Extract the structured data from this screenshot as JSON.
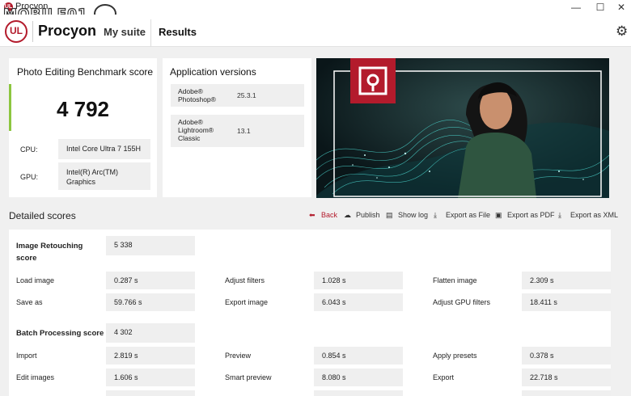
{
  "window": {
    "title": "Procyon",
    "watermark": "MOBILE01",
    "controls": [
      "—",
      "☐",
      "✕"
    ]
  },
  "app": {
    "logo": "UL",
    "brand": "Procyon",
    "nav": [
      "My suite",
      "Results"
    ],
    "active_tab": "Results",
    "accent": "#b31b2c"
  },
  "score_card": {
    "title": "Photo Editing Benchmark score",
    "score": "4 792",
    "cpu_label": "CPU:",
    "cpu_value": "Intel Core Ultra 7 155H",
    "gpu_label": "GPU:",
    "gpu_value": "Intel(R) Arc(TM) Graphics"
  },
  "app_versions": {
    "title": "Application versions",
    "items": [
      {
        "name": "Adobe® Photoshop®",
        "version": "25.3.1"
      },
      {
        "name": "Adobe® Lightroom® Classic",
        "version": "13.1"
      }
    ]
  },
  "detailed": {
    "title": "Detailed scores",
    "actions": [
      "Back",
      "Publish",
      "Show log",
      "Export as File",
      "Export as PDF",
      "Export as XML"
    ],
    "retouching": {
      "label": "Image Retouching score",
      "score": "5 338",
      "rows": [
        [
          {
            "label": "Load image",
            "value": "0.287 s"
          },
          {
            "label": "Adjust filters",
            "value": "1.028 s"
          },
          {
            "label": "Flatten image",
            "value": "2.309 s"
          }
        ],
        [
          {
            "label": "Save as",
            "value": "59.766 s"
          },
          {
            "label": "Export image",
            "value": "6.043 s"
          },
          {
            "label": "Adjust GPU filters",
            "value": "18.411 s"
          }
        ]
      ]
    },
    "batch": {
      "label": "Batch Processing score",
      "score": "4 302",
      "rows": [
        [
          {
            "label": "Import",
            "value": "2.819 s"
          },
          {
            "label": "Preview",
            "value": "0.854 s"
          },
          {
            "label": "Apply presets",
            "value": "0.378 s"
          }
        ],
        [
          {
            "label": "Edit images",
            "value": "1.606 s"
          },
          {
            "label": "Smart preview",
            "value": "8.080 s"
          },
          {
            "label": "Export",
            "value": "22.718 s"
          }
        ]
      ]
    }
  }
}
